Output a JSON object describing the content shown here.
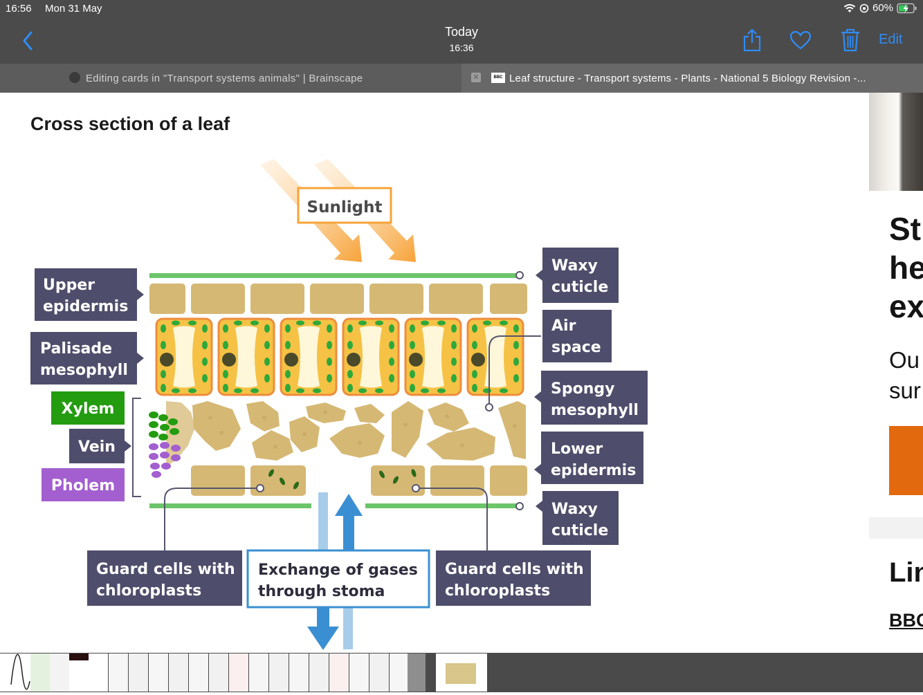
{
  "status": {
    "time": "16:56",
    "date": "Mon 31 May",
    "battery": "60%"
  },
  "nav": {
    "title": "Today",
    "subtitle": "16:36",
    "edit_label": "Edit",
    "icons": [
      "back-chevron-icon",
      "share-icon",
      "heart-icon",
      "trash-icon"
    ]
  },
  "tabs": [
    {
      "label": "Editing cards in \"Transport systems animals\" | Brainscape"
    },
    {
      "label": "Leaf structure - Transport systems - Plants - National 5 Biology Revision -...",
      "favicon": "BBC"
    }
  ],
  "page": {
    "heading": "Cross section of a leaf"
  },
  "diagram": {
    "sunlight": "Sunlight",
    "left_labels": {
      "upper1": "Upper",
      "upper2": "epidermis",
      "pal1": "Palisade",
      "pal2": "mesophyll",
      "xylem": "Xylem",
      "vein": "Vein",
      "phloem": "Pholem"
    },
    "right_labels": {
      "wax1a": "Waxy",
      "wax1b": "cuticle",
      "air1": "Air",
      "air2": "space",
      "spo1": "Spongy",
      "spo2": "mesophyll",
      "low1": "Lower",
      "low2": "epidermis",
      "wax2a": "Waxy",
      "wax2b": "cuticle"
    },
    "bottom_labels": {
      "g1a": "Guard cells with",
      "g1b": "chloroplasts",
      "ex1": "Exchange of gases",
      "ex2": "through stoma",
      "g2a": "Guard cells with",
      "g2b": "chloroplasts"
    },
    "colors": {
      "label_bg": "#4e4d6b",
      "xylem": "#239c10",
      "phloem": "#a35fcf",
      "cell": "#d5b874",
      "palisade_border": "#ef8c3b",
      "chloroplast": "#2ea83a",
      "cuticle": "#6cc56a",
      "sun": "#f7a339",
      "arrow": "#3a8fd2"
    }
  },
  "right_panel": {
    "heading_lines": [
      "St",
      "he",
      "ex"
    ],
    "body_lines": [
      "Ou",
      "sur"
    ],
    "link_heading": "Lin",
    "link": "BBC"
  },
  "dock": {
    "thumbnail_count": 22
  }
}
